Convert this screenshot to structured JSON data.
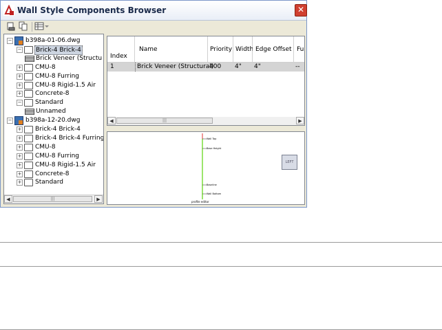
{
  "window": {
    "title": "Wall Style Components Browser",
    "close_label": "✕"
  },
  "toolbar": {
    "icons": [
      "new-component-icon",
      "copy-component-icon",
      "view-options-icon"
    ]
  },
  "tree": {
    "nodes": [
      {
        "label": "b398a-01-06.dwg",
        "kind": "drawing",
        "expander": "−"
      },
      {
        "label": "Brick-4 Brick-4",
        "kind": "folder",
        "expander": "−",
        "selected": true
      },
      {
        "label": "Brick Veneer (Structu",
        "kind": "component"
      },
      {
        "label": "CMU-8",
        "kind": "folder",
        "expander": "+"
      },
      {
        "label": "CMU-8 Furring",
        "kind": "folder",
        "expander": "+"
      },
      {
        "label": "CMU-8 Rigid-1.5 Air",
        "kind": "folder",
        "expander": "+"
      },
      {
        "label": "Concrete-8",
        "kind": "folder",
        "expander": "+"
      },
      {
        "label": "Standard",
        "kind": "folder",
        "expander": "−"
      },
      {
        "label": "Unnamed",
        "kind": "component"
      },
      {
        "label": "b398a-12-20.dwg",
        "kind": "drawing",
        "expander": "−"
      },
      {
        "label": "Brick-4 Brick-4",
        "kind": "folder",
        "expander": "+"
      },
      {
        "label": "Brick-4 Brick-4 Furring",
        "kind": "folder",
        "expander": "+"
      },
      {
        "label": "CMU-8",
        "kind": "folder",
        "expander": "+"
      },
      {
        "label": "CMU-8 Furring",
        "kind": "folder",
        "expander": "+"
      },
      {
        "label": "CMU-8 Rigid-1.5 Air",
        "kind": "folder",
        "expander": "+"
      },
      {
        "label": "Concrete-8",
        "kind": "folder",
        "expander": "+"
      },
      {
        "label": "Standard",
        "kind": "folder",
        "expander": "+"
      }
    ]
  },
  "grid": {
    "columns": [
      "Index",
      "Name",
      "Priority",
      "Width",
      "Edge Offset",
      "Fu"
    ],
    "rows": [
      [
        "1",
        "Brick Veneer (Structural)",
        "400",
        "4\"",
        "4\"",
        "--"
      ]
    ]
  },
  "preview": {
    "labels": {
      "wall_top": "Wall Top",
      "base_height": "Base Height",
      "baseline": "Baseline",
      "wall_bottom": "Wall Bottom",
      "profile": "profile editor"
    },
    "left_button": "LEFT",
    "colors": {
      "wall_line": "#7adc3a",
      "top_marker": "#e03030"
    }
  }
}
